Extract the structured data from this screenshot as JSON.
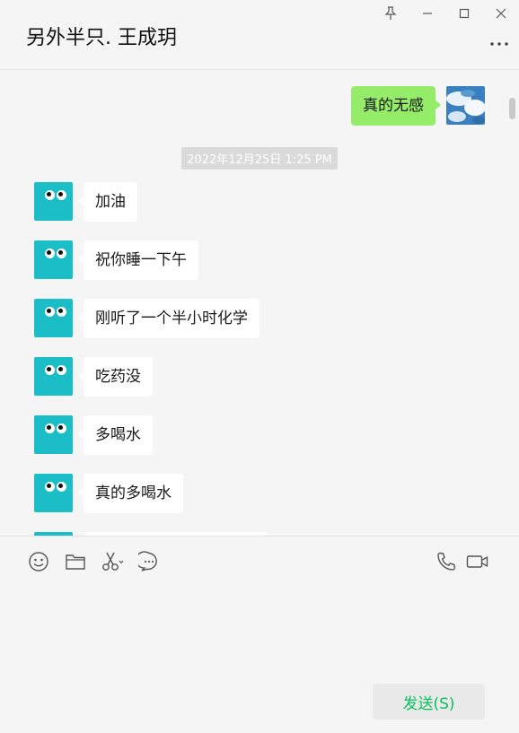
{
  "header": {
    "title": "另外半只. 王成玥"
  },
  "chat": {
    "my_message": "真的无感",
    "timestamp": "2022年12月25日 1:25 PM",
    "messages": [
      {
        "text": "加油"
      },
      {
        "text": "祝你睡一下午"
      },
      {
        "text": "刚听了一个半小时化学"
      },
      {
        "text": "吃药没"
      },
      {
        "text": "多喝水"
      },
      {
        "text": "真的多喝水"
      }
    ]
  },
  "composer": {
    "send_label": "发送(S)"
  },
  "colors": {
    "my_bubble": "#95ec69",
    "their_bubble": "#ffffff",
    "avatar_bg": "#1bbdc6",
    "send_text": "#07c160"
  }
}
